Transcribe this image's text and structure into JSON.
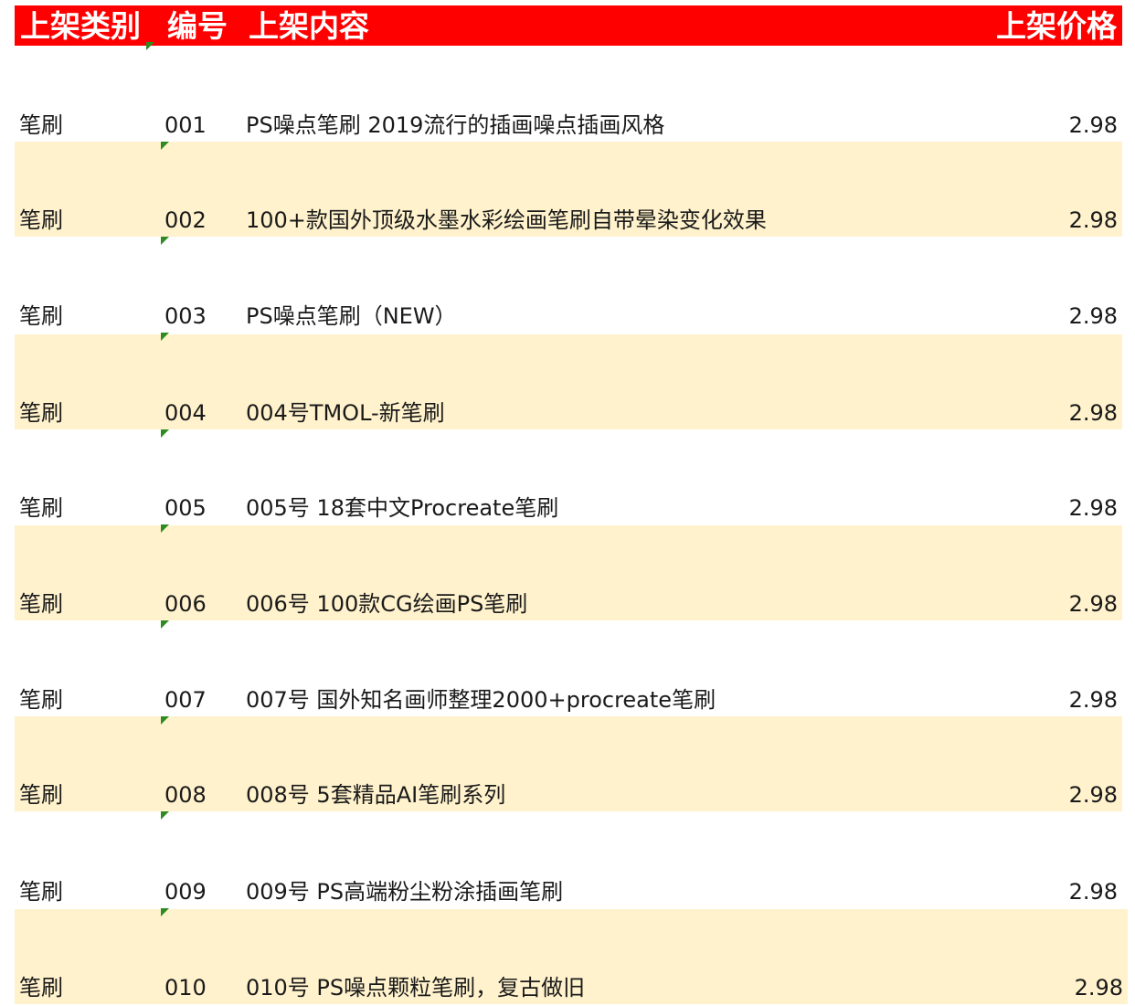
{
  "header": {
    "category": "上架类别",
    "number": "编号",
    "content": "上架内容",
    "price": "上架价格"
  },
  "colors": {
    "header_bg": "#ff0000",
    "header_text": "#ffffff",
    "alt_row_bg": "#fff2cc",
    "marker": "#2e8b22"
  },
  "rows": [
    {
      "category": "笔刷",
      "number": "001",
      "content": "PS噪点笔刷 2019流行的插画噪点插画风格",
      "price": "2.98"
    },
    {
      "category": "笔刷",
      "number": "002",
      "content": "100+款国外顶级水墨水彩绘画笔刷自带晕染变化效果",
      "price": "2.98"
    },
    {
      "category": "笔刷",
      "number": "003",
      "content": "PS噪点笔刷（NEW）",
      "price": "2.98"
    },
    {
      "category": "笔刷",
      "number": "004",
      "content": "004号TMOL-新笔刷",
      "price": "2.98"
    },
    {
      "category": "笔刷",
      "number": "005",
      "content": "005号 18套中文Procreate笔刷",
      "price": "2.98"
    },
    {
      "category": "笔刷",
      "number": "006",
      "content": "006号 100款CG绘画PS笔刷",
      "price": "2.98"
    },
    {
      "category": "笔刷",
      "number": "007",
      "content": "007号 国外知名画师整理2000+procreate笔刷",
      "price": "2.98"
    },
    {
      "category": "笔刷",
      "number": "008",
      "content": "008号 5套精品AI笔刷系列",
      "price": "2.98"
    },
    {
      "category": "笔刷",
      "number": "009",
      "content": "009号 PS高端粉尘粉涂插画笔刷",
      "price": "2.98"
    },
    {
      "category": "笔刷",
      "number": "010",
      "content": "010号 PS噪点颗粒笔刷，复古做旧",
      "price": "2.98"
    }
  ]
}
